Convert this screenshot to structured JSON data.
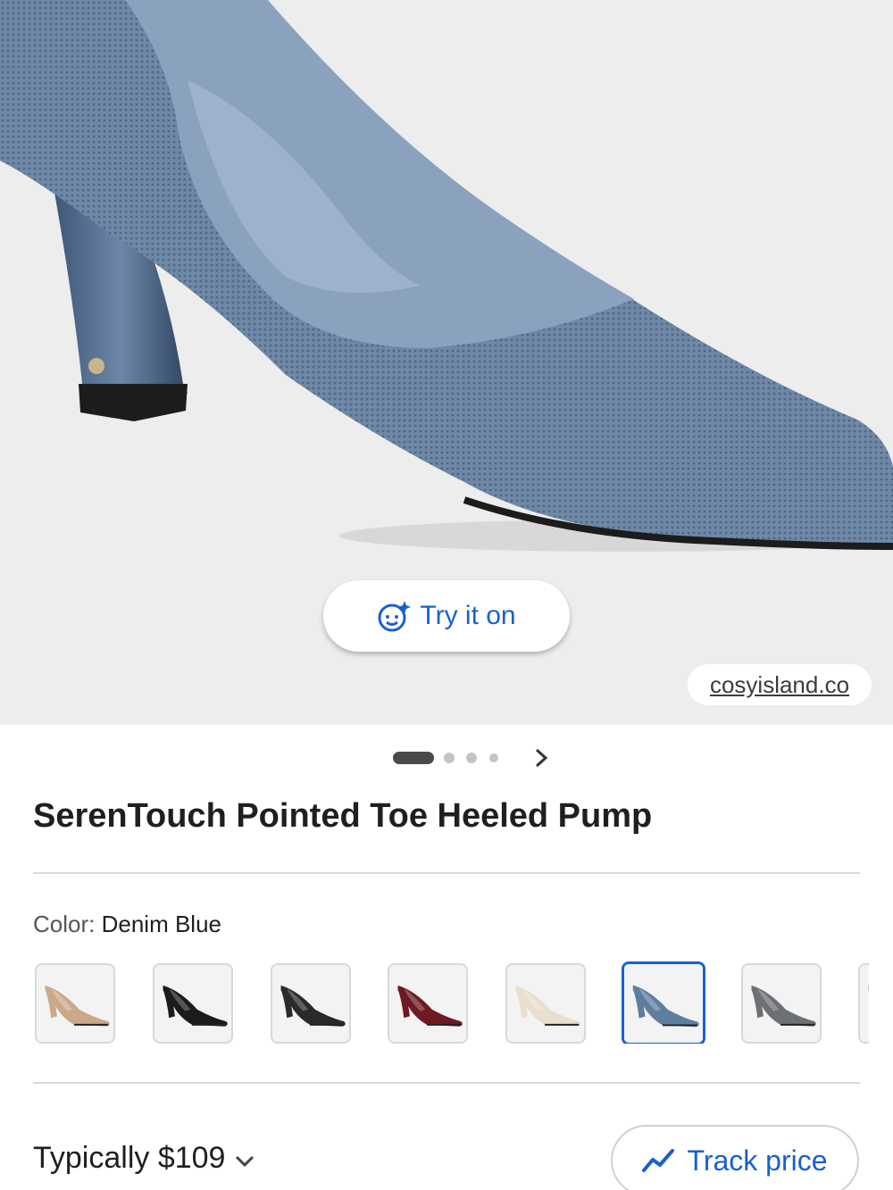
{
  "hero": {
    "try_on_label": "Try it on",
    "try_on_icon": "face-sparkle-icon",
    "source": "cosyisland.co",
    "image_alt": "blue knit pointed toe heeled pump"
  },
  "pager": {
    "total": 4,
    "active": 0
  },
  "product": {
    "title": "SerenTouch Pointed Toe Heeled Pump"
  },
  "color": {
    "label": "Color:",
    "selected": "Denim Blue",
    "swatches": [
      {
        "name": "tan",
        "color": "#c9a98a"
      },
      {
        "name": "black",
        "color": "#1b1b1b"
      },
      {
        "name": "black-pattern",
        "color": "#2a2a2a"
      },
      {
        "name": "burgundy",
        "color": "#6e1a22"
      },
      {
        "name": "cream",
        "color": "#e8dfcc"
      },
      {
        "name": "denim-blue",
        "color": "#5e7ea0",
        "selected": true
      },
      {
        "name": "gray",
        "color": "#6c6f73"
      },
      {
        "name": "leopard",
        "color": "#a88c6a"
      }
    ]
  },
  "price": {
    "label": "Typically $109",
    "chevron_icon": "chevron-down-icon"
  },
  "track": {
    "label": "Track price",
    "icon": "trend-line-icon"
  },
  "colors": {
    "accent": "#1a5fd0",
    "hero_bg": "#ededed"
  }
}
